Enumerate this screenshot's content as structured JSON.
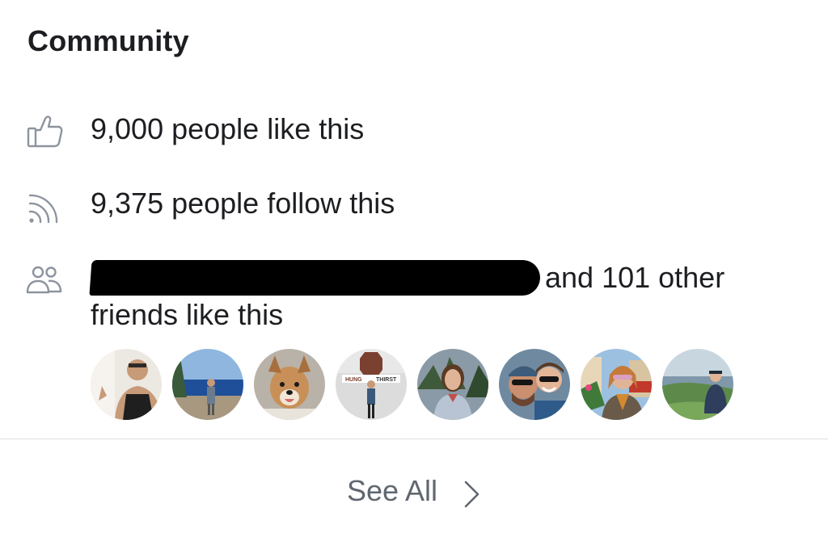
{
  "header": {
    "title": "Community"
  },
  "likes": {
    "text": "9,000 people like this",
    "icon": "thumbs-up-icon"
  },
  "follows": {
    "text": "9,375 people follow this",
    "icon": "rss-feed-icon"
  },
  "friends": {
    "text_line1_tail": "and 101 other",
    "text_line2": "friends like this",
    "icon": "people-icon",
    "avatars": [
      "friend-avatar-1",
      "friend-avatar-2",
      "friend-avatar-3",
      "friend-avatar-4",
      "friend-avatar-5",
      "friend-avatar-6",
      "friend-avatar-7",
      "friend-avatar-8"
    ]
  },
  "avatar_sign_text": {
    "left": "HUNG",
    "right": "THIRST"
  },
  "footer": {
    "see_all_label": "See All",
    "icon": "chevron-right-icon"
  },
  "colors": {
    "text_primary": "#1c1e21",
    "text_secondary": "#606770",
    "icon_gray": "#8d949e",
    "divider": "#dddfe2"
  }
}
